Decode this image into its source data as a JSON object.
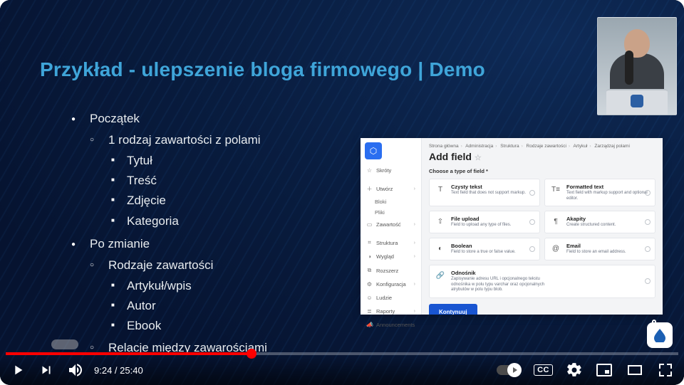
{
  "slide": {
    "title": "Przykład - ulepszenie bloga firmowego | Demo",
    "section1": {
      "heading": "Początek",
      "sub1": "1 rodzaj zawartości z polami",
      "items": [
        "Tytuł",
        "Treść",
        "Zdjęcie",
        "Kategoria"
      ]
    },
    "section2": {
      "heading": "Po zmianie",
      "sub1": "Rodzaje zawartości",
      "items": [
        "Artykuł/wpis",
        "Autor",
        "Ebook"
      ],
      "sub2": "Relacje między zawarościami"
    }
  },
  "cms": {
    "breadcrumb": [
      "Strona główna",
      "Administracja",
      "Struktura",
      "Rodzaje zawartości",
      "Artykuł",
      "Zarządzaj polami"
    ],
    "heading": "Add field",
    "section_label": "Choose a type of field *",
    "nav": {
      "shortcuts": "Skróty",
      "create": "Utwórz",
      "blocks": "Bloki",
      "files": "Pliki",
      "content": "Zawartość",
      "structure": "Struktura",
      "appearance": "Wygląd",
      "extend": "Rozszerz",
      "config": "Konfiguracja",
      "people": "Ludzie",
      "reports": "Raporty",
      "announcements": "Announcements"
    },
    "cards": [
      {
        "icon": "T",
        "title": "Czysty tekst",
        "desc": "Text field that does not support markup."
      },
      {
        "icon": "T≡",
        "title": "Formatted text",
        "desc": "Text field with markup support and optional editor."
      },
      {
        "icon": "⇧",
        "title": "File upload",
        "desc": "Field to upload any type of files."
      },
      {
        "icon": "¶",
        "title": "Akapity",
        "desc": "Create structured content."
      },
      {
        "icon": "◐",
        "title": "Boolean",
        "desc": "Field to store a true or false value."
      },
      {
        "icon": "@",
        "title": "Email",
        "desc": "Field to store an email address."
      },
      {
        "icon": "🔗",
        "title": "Odnośnik",
        "desc": "Zapisywanie adresu URL i opcjonalnego tekstu odnośnika w polu typu varchar oraz opcjonalnych atrybutów w polu typu blob."
      }
    ],
    "button": "Kontynuuj"
  },
  "player": {
    "current": "9:24",
    "duration": "25:40",
    "progress_pct": 36.5,
    "cc": "CC"
  }
}
